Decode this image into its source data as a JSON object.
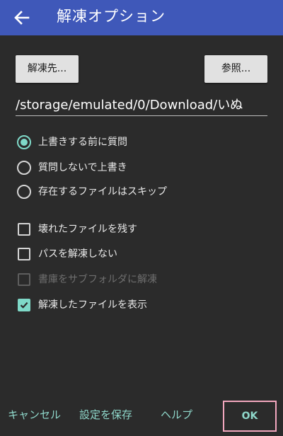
{
  "appbar": {
    "title": "解凍オプション",
    "back_icon": "arrow-back-icon",
    "background_color": "#3f58b9"
  },
  "destination": {
    "dest_button_label": "解凍先...",
    "browse_button_label": "参照...",
    "path_value": "/storage/emulated/0/Download/いぬ"
  },
  "overwrite_options": [
    {
      "label": "上書きする前に質問",
      "selected": true
    },
    {
      "label": "質問しないで上書き",
      "selected": false
    },
    {
      "label": "存在するファイルはスキップ",
      "selected": false
    }
  ],
  "checkbox_options": [
    {
      "label": "壊れたファイルを残す",
      "checked": false,
      "enabled": true
    },
    {
      "label": "パスを解凍しない",
      "checked": false,
      "enabled": true
    },
    {
      "label": "書庫をサブフォルダに解凍",
      "checked": false,
      "enabled": false
    },
    {
      "label": "解凍したファイルを表示",
      "checked": true,
      "enabled": true
    }
  ],
  "footer": {
    "cancel_label": "キャンセル",
    "save_label": "設定を保存",
    "help_label": "ヘルプ",
    "ok_label": "OK"
  },
  "colors": {
    "accent": "#7fd9c8",
    "background": "#2b2b2b",
    "highlight_border": "#f2a7be"
  }
}
